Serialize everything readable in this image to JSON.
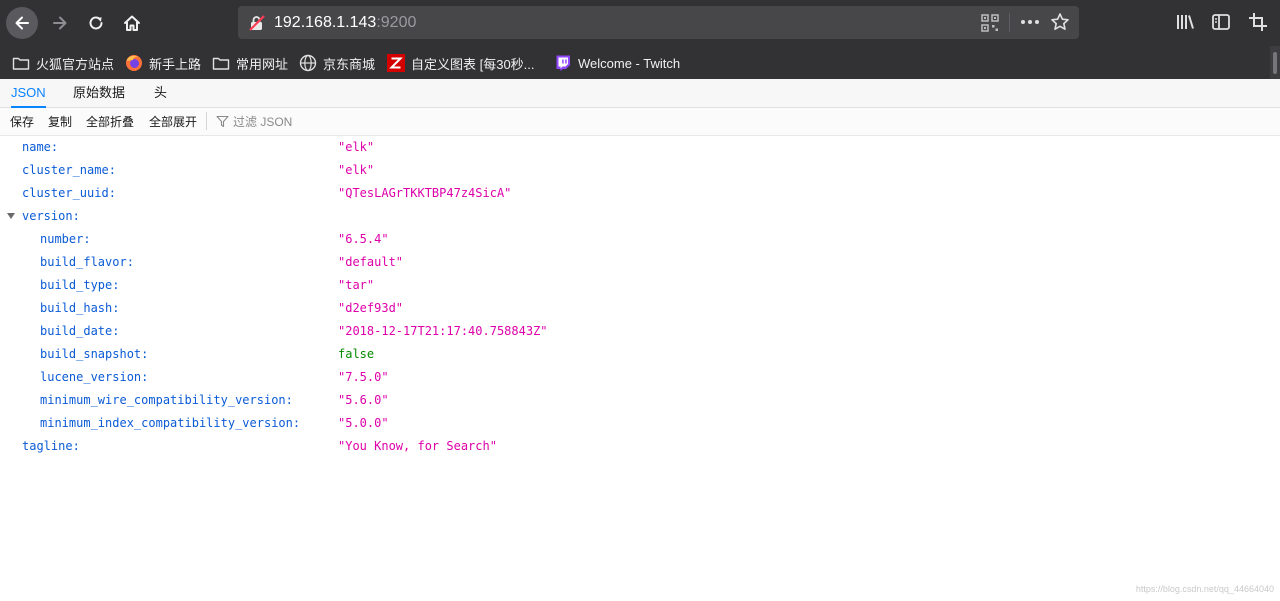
{
  "browser": {
    "url_host": "192.168.1.143",
    "url_port": ":9200",
    "bookmarks": [
      {
        "label": "火狐官方站点",
        "icon": "folder-icon"
      },
      {
        "label": "新手上路",
        "icon": "firefox-icon"
      },
      {
        "label": "常用网址",
        "icon": "folder-icon"
      },
      {
        "label": "京东商城",
        "icon": "globe-icon"
      },
      {
        "label": "自定义图表 [每30秒...",
        "icon": "z-logo-icon"
      },
      {
        "label": "Welcome - Twitch",
        "icon": "twitch-icon"
      }
    ]
  },
  "viewer": {
    "tabs": [
      "JSON",
      "原始数据",
      "头"
    ],
    "active_tab": "JSON",
    "toolbar": {
      "save": "保存",
      "copy": "复制",
      "collapse_all": "全部折叠",
      "expand_all": "全部展开",
      "filter_placeholder": "过滤 JSON"
    }
  },
  "json": [
    {
      "key": "name:",
      "value": "\"elk\"",
      "type": "string",
      "indent": 0
    },
    {
      "key": "cluster_name:",
      "value": "\"elk\"",
      "type": "string",
      "indent": 0
    },
    {
      "key": "cluster_uuid:",
      "value": "\"QTesLAGrTKKTBP47z4SicA\"",
      "type": "string",
      "indent": 0
    },
    {
      "key": "version:",
      "value": "",
      "type": "object",
      "indent": 0
    },
    {
      "key": "number:",
      "value": "\"6.5.4\"",
      "type": "string",
      "indent": 1
    },
    {
      "key": "build_flavor:",
      "value": "\"default\"",
      "type": "string",
      "indent": 1
    },
    {
      "key": "build_type:",
      "value": "\"tar\"",
      "type": "string",
      "indent": 1
    },
    {
      "key": "build_hash:",
      "value": "\"d2ef93d\"",
      "type": "string",
      "indent": 1
    },
    {
      "key": "build_date:",
      "value": "\"2018-12-17T21:17:40.758843Z\"",
      "type": "string",
      "indent": 1
    },
    {
      "key": "build_snapshot:",
      "value": "false",
      "type": "bool",
      "indent": 1
    },
    {
      "key": "lucene_version:",
      "value": "\"7.5.0\"",
      "type": "string",
      "indent": 1
    },
    {
      "key": "minimum_wire_compatibility_version:",
      "value": "\"5.6.0\"",
      "type": "string",
      "indent": 1
    },
    {
      "key": "minimum_index_compatibility_version:",
      "value": "\"5.0.0\"",
      "type": "string",
      "indent": 1
    },
    {
      "key": "tagline:",
      "value": "\"You Know, for Search\"",
      "type": "string",
      "indent": 0
    }
  ],
  "watermark": "https://blog.csdn.net/qq_44664040",
  "colors": {
    "key": "#0b5bd6",
    "string": "#dd00a9",
    "bool": "#058b00",
    "accent": "#0a84ff"
  }
}
